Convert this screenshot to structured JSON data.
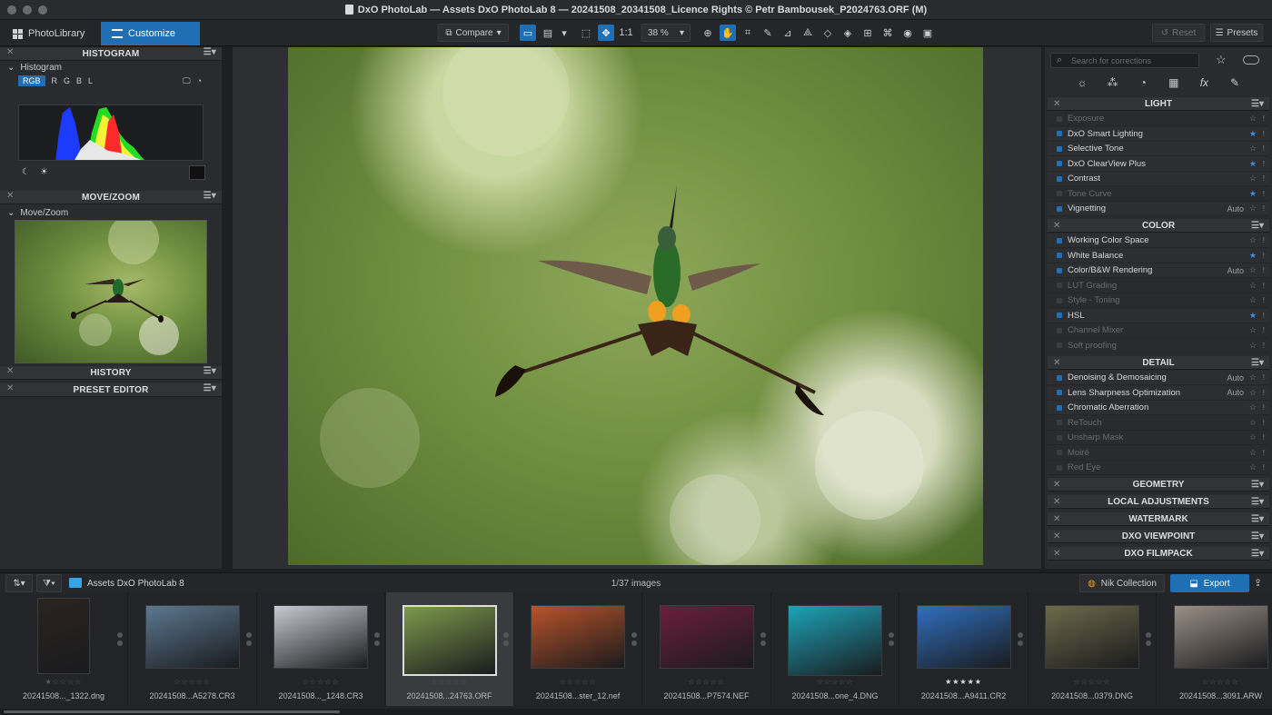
{
  "window": {
    "title": "DxO PhotoLab — Assets DxO PhotoLab 8 — 20241508_20341508_Licence Rights © Petr Bambousek_P2024763.ORF (M)"
  },
  "tabs": {
    "library": "PhotoLibrary",
    "customize": "Customize"
  },
  "toolbar": {
    "compare": "Compare",
    "zoom_fit": "1:1",
    "zoom": "38 %",
    "reset": "Reset",
    "presets": "Presets"
  },
  "left": {
    "histogram_title": "HISTOGRAM",
    "histogram_sub": "Histogram",
    "channels": [
      "RGB",
      "R",
      "G",
      "B",
      "L"
    ],
    "movezoom_title": "MOVE/ZOOM",
    "movezoom_sub": "Move/Zoom",
    "history_title": "HISTORY",
    "preset_editor_title": "PRESET EDITOR"
  },
  "right": {
    "search_placeholder": "Search for corrections",
    "sections": {
      "light": "LIGHT",
      "color": "COLOR",
      "detail": "DETAIL",
      "geometry": "GEOMETRY",
      "local": "LOCAL ADJUSTMENTS",
      "watermark": "WATERMARK",
      "viewpoint": "DXO VIEWPOINT",
      "filmpack": "DXO FILMPACK"
    },
    "light_items": [
      {
        "label": "Exposure",
        "on": false,
        "auto": "",
        "fav": false
      },
      {
        "label": "DxO Smart Lighting",
        "on": true,
        "auto": "",
        "fav": true
      },
      {
        "label": "Selective Tone",
        "on": true,
        "auto": "",
        "fav": false
      },
      {
        "label": "DxO ClearView Plus",
        "on": true,
        "auto": "",
        "fav": true
      },
      {
        "label": "Contrast",
        "on": true,
        "auto": "",
        "fav": false
      },
      {
        "label": "Tone Curve",
        "on": false,
        "auto": "",
        "fav": true
      },
      {
        "label": "Vignetting",
        "on": true,
        "auto": "Auto",
        "fav": false
      }
    ],
    "color_items": [
      {
        "label": "Working Color Space",
        "on": true,
        "auto": "",
        "fav": false
      },
      {
        "label": "White Balance",
        "on": true,
        "auto": "",
        "fav": true
      },
      {
        "label": "Color/B&W Rendering",
        "on": true,
        "auto": "Auto",
        "fav": false
      },
      {
        "label": "LUT Grading",
        "on": false,
        "auto": "",
        "fav": false
      },
      {
        "label": "Style - Toning",
        "on": false,
        "auto": "",
        "fav": false
      },
      {
        "label": "HSL",
        "on": true,
        "auto": "",
        "fav": true
      },
      {
        "label": "Channel Mixer",
        "on": false,
        "auto": "",
        "fav": false
      },
      {
        "label": "Soft proofing",
        "on": false,
        "auto": "",
        "fav": false
      }
    ],
    "detail_items": [
      {
        "label": "Denoising & Demosaicing",
        "on": true,
        "auto": "Auto",
        "fav": false
      },
      {
        "label": "Lens Sharpness Optimization",
        "on": true,
        "auto": "Auto",
        "fav": false
      },
      {
        "label": "Chromatic Aberration",
        "on": true,
        "auto": "",
        "fav": false
      },
      {
        "label": "ReTouch",
        "on": false,
        "auto": "",
        "fav": false
      },
      {
        "label": "Unsharp Mask",
        "on": false,
        "auto": "",
        "fav": false
      },
      {
        "label": "Moiré",
        "on": false,
        "auto": "",
        "fav": false
      },
      {
        "label": "Red Eye",
        "on": false,
        "auto": "",
        "fav": false
      }
    ]
  },
  "filmstrip": {
    "folder": "Assets DxO PhotoLab 8",
    "count": "1/37 images",
    "nik": "Nik Collection",
    "export": "Export",
    "items": [
      {
        "name": "20241508..._1322.dng",
        "stars": "★☆☆☆☆",
        "color": "#2a2320"
      },
      {
        "name": "20241508...A5278.CR3",
        "stars": "☆☆☆☆☆",
        "color": "#5c7891"
      },
      {
        "name": "20241508..._1248.CR3",
        "stars": "☆☆☆☆☆",
        "color": "#c9cad2"
      },
      {
        "name": "20241508...24763.ORF",
        "stars": "☆☆☆☆☆",
        "color": "#7c9a4c"
      },
      {
        "name": "20241508...ster_12.nef",
        "stars": "☆☆☆☆☆",
        "color": "#b9532a"
      },
      {
        "name": "20241508...P7574.NEF",
        "stars": "☆☆☆☆☆",
        "color": "#6b1f3a"
      },
      {
        "name": "20241508...one_4.DNG",
        "stars": "☆☆☆☆☆",
        "color": "#1da3b8"
      },
      {
        "name": "20241508...A9411.CR2",
        "stars": "★★★★★",
        "color": "#2f6fbf"
      },
      {
        "name": "20241508...0379.DNG",
        "stars": "☆☆☆☆☆",
        "color": "#6d6a4a"
      },
      {
        "name": "20241508...3091.ARW",
        "stars": "☆☆☆☆☆",
        "color": "#9a8f86"
      }
    ]
  }
}
